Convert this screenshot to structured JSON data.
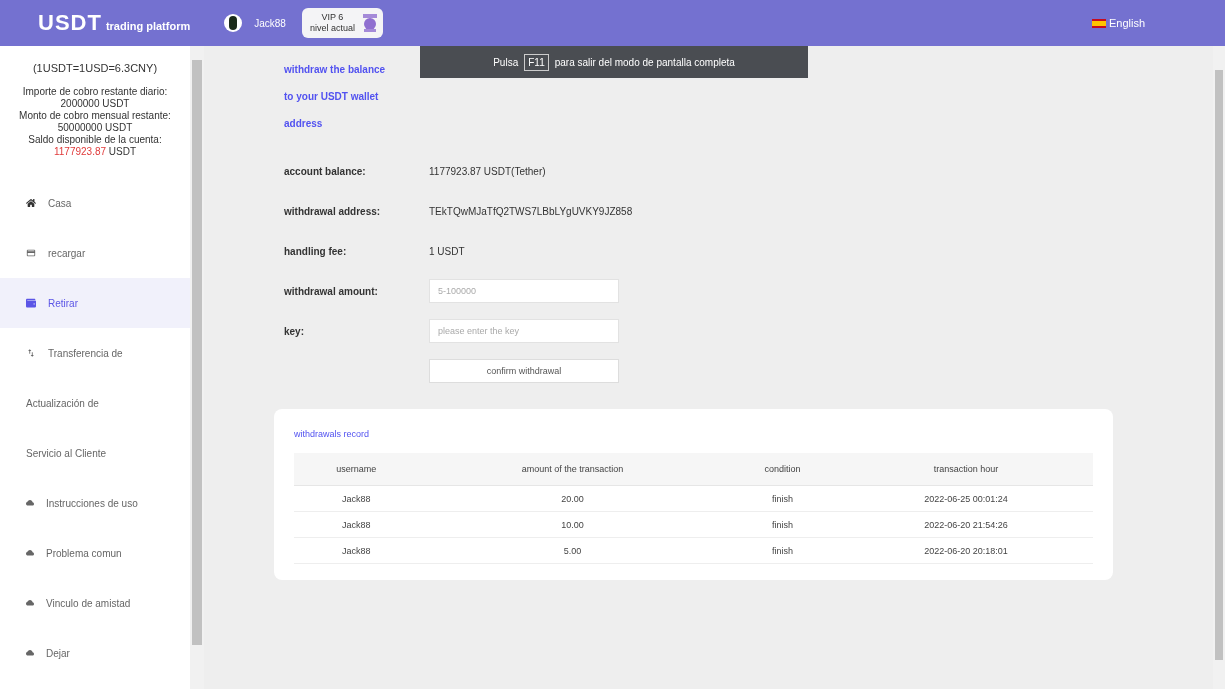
{
  "header": {
    "logo": "USDT",
    "logo_sub": "trading platform",
    "username": "Jack88",
    "vip_level": "VIP 6",
    "vip_caption": "nivel actual",
    "language": "English"
  },
  "toast": {
    "before": "Pulsa",
    "key": "F11",
    "after": "para salir del modo de pantalla completa"
  },
  "sidebar": {
    "rate": "(1USDT=1USD=6.3CNY)",
    "info": [
      {
        "text": "Importe de cobro restante diario:"
      },
      {
        "text": "2000000 USDT"
      },
      {
        "text": "Monto de cobro mensual restante:"
      },
      {
        "text": "50000000 USDT"
      },
      {
        "text": "Saldo disponible de la cuenta:"
      }
    ],
    "balance": "1177923.87",
    "balance_unit": "USDT",
    "items": [
      {
        "label": "Casa",
        "selected": false
      },
      {
        "label": "recargar",
        "selected": false
      },
      {
        "label": "Retirar",
        "selected": true
      },
      {
        "label": "Transferencia de",
        "selected": false
      },
      {
        "label": "Actualización de",
        "selected": false
      },
      {
        "label": "Servicio al Cliente",
        "selected": false
      },
      {
        "label": "Instrucciones de uso",
        "selected": false
      },
      {
        "label": "Problema comun",
        "selected": false
      },
      {
        "label": "Vinculo de amistad",
        "selected": false
      },
      {
        "label": "Dejar",
        "selected": false
      }
    ]
  },
  "main": {
    "intro": [
      "withdraw the balance",
      "to your USDT wallet",
      "address"
    ],
    "fields": [
      {
        "kind": "text",
        "label": "account balance:",
        "value": "1177923.87 USDT(Tether)"
      },
      {
        "kind": "text",
        "label": "withdrawal address:",
        "value": "TEkTQwMJaTfQ2TWS7LBbLYgUVKY9JZ858"
      },
      {
        "kind": "text",
        "label": "handling fee:",
        "value": "1 USDT"
      },
      {
        "kind": "input",
        "label": "withdrawal amount:",
        "placeholder": "5-100000"
      },
      {
        "kind": "input",
        "label": "key:",
        "placeholder": "please enter the key"
      }
    ],
    "confirm_button": "confirm withdrawal",
    "record": {
      "title": "withdrawals record",
      "columns": [
        "username",
        "amount of the transaction",
        "condition",
        "transaction hour"
      ],
      "rows": [
        [
          "Jack88",
          "20.00",
          "finish",
          "2022-06-25 00:01:24"
        ],
        [
          "Jack88",
          "10.00",
          "finish",
          "2022-06-20 21:54:26"
        ],
        [
          "Jack88",
          "5.00",
          "finish",
          "2022-06-20 20:18:01"
        ]
      ]
    }
  }
}
